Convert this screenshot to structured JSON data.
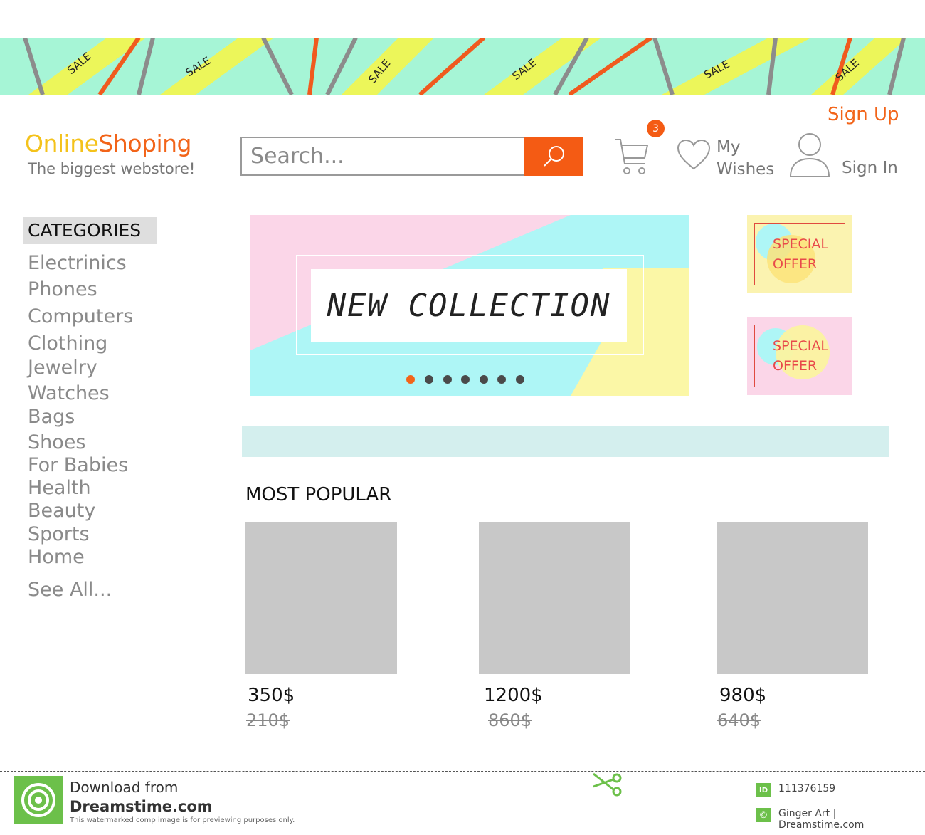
{
  "sale_strip": {
    "label": "SALE"
  },
  "header": {
    "logo_part1": "Online",
    "logo_part2": "Shoping",
    "tagline": "The biggest webstore!",
    "search_placeholder": "Search...",
    "cart_count": "3",
    "wishes_line1": "My",
    "wishes_line2": "Wishes",
    "sign_in": "Sign In",
    "sign_up": "Sign Up"
  },
  "sidebar": {
    "heading": "CATEGORIES",
    "items": [
      "Electrinics",
      "Phones",
      "Computers",
      "Clothing",
      "Jewelry",
      "Watches",
      "Bags",
      "Shoes",
      "For Babies",
      "Health",
      "Beauty",
      "Sports",
      "Home"
    ],
    "see_all": "See All..."
  },
  "banner": {
    "title": "NEW COLLECTION",
    "slide_count": 7,
    "active_slide": 1
  },
  "offers": [
    {
      "line1": "SPECIAL",
      "line2": "OFFER"
    },
    {
      "line1": "SPECIAL",
      "line2": "OFFER"
    }
  ],
  "popular": {
    "heading": "MOST POPULAR",
    "products": [
      {
        "price": "350$",
        "old_price": "210$"
      },
      {
        "price": "1200$",
        "old_price": "860$"
      },
      {
        "price": "980$",
        "old_price": "640$"
      }
    ]
  },
  "footer": {
    "download_from": "Download from",
    "site": "Dreamstime.com",
    "note": "This watermarked comp image is for previewing purposes only.",
    "id_label": "ID",
    "id_number": "111376159",
    "credit": "Ginger Art | Dreamstime.com"
  },
  "colors": {
    "accent_orange": "#f45b14",
    "logo_yellow": "#f4c21a",
    "strip_mint": "#a6f5d6",
    "strip_yellow": "#ecf65a",
    "banner_pink": "#fbd6e8",
    "banner_cyan": "#aef6f6",
    "banner_yellow": "#fbf7a6",
    "teal_bar": "#d4efee",
    "product_gray": "#c8c8c8"
  }
}
